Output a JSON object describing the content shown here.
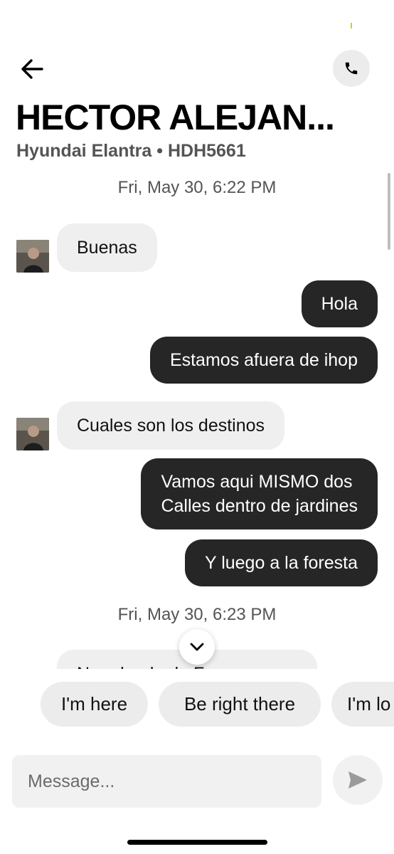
{
  "header": {
    "title": "HECTOR ALEJAN...",
    "subtitle": "Hyundai Elantra • HDH5661",
    "back_icon": "arrow-left-icon",
    "call_icon": "phone-icon"
  },
  "messages": [
    {
      "type": "timestamp",
      "text": "Fri, May 30, 6:22 PM"
    },
    {
      "type": "incoming",
      "text": "Buenas"
    },
    {
      "type": "outgoing",
      "text": "Hola"
    },
    {
      "type": "outgoing",
      "text": "Estamos afuera de ihop"
    },
    {
      "type": "incoming",
      "text": "Cuales son los destinos"
    },
    {
      "type": "outgoing",
      "text": "Vamos aqui MISMO dos\nCalles dentro de jardines"
    },
    {
      "type": "outgoing",
      "text": "Y luego a la foresta"
    },
    {
      "type": "timestamp",
      "text": "Fri, May 30, 6:23 PM"
    },
    {
      "type": "incoming",
      "text": "No adonde de F..."
    }
  ],
  "quick_replies": [
    "I'm here",
    "Be right there",
    "I'm lo"
  ],
  "composer": {
    "placeholder": "Message...",
    "send_icon": "send-icon"
  },
  "colors": {
    "outgoing_bubble": "#262626",
    "incoming_bubble": "#efefef",
    "chip_bg": "#ececec"
  }
}
